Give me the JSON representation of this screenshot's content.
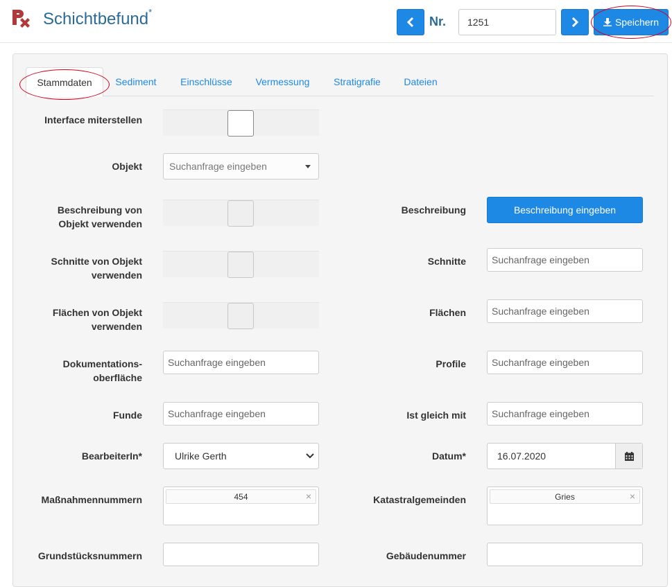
{
  "header": {
    "title": "Schichtbefund",
    "title_marker": "*",
    "nr_label": "Nr.",
    "nr_value": "1251",
    "save_label": "Speichern",
    "icons": [
      "app-logo-icon",
      "chevron-left-icon",
      "chevron-right-icon",
      "download-icon"
    ]
  },
  "tabs": [
    {
      "label": "Stammdaten",
      "active": true
    },
    {
      "label": "Sediment",
      "active": false
    },
    {
      "label": "Einschlüsse",
      "active": false
    },
    {
      "label": "Vermessung",
      "active": false
    },
    {
      "label": "Stratigrafie",
      "active": false
    },
    {
      "label": "Dateien",
      "active": false
    }
  ],
  "form": {
    "interface_label": "Interface miterstellen",
    "objekt_label": "Objekt",
    "objekt_placeholder": "Suchanfrage eingeben",
    "beschr_obj_label_1": "Beschreibung von",
    "beschr_obj_label_2": "Objekt verwenden",
    "beschreibung_label": "Beschreibung",
    "beschreibung_button": "Beschreibung eingeben",
    "schnitte_obj_label_1": "Schnitte von Objekt",
    "schnitte_obj_label_2": "verwenden",
    "schnitte_label": "Schnitte",
    "schnitte_placeholder": "Suchanfrage eingeben",
    "flaechen_obj_label_1": "Flächen von Objekt",
    "flaechen_obj_label_2": "verwenden",
    "flaechen_label": "Flächen",
    "flaechen_placeholder": "Suchanfrage eingeben",
    "doku_label_1": "Dokumentations-",
    "doku_label_2": "oberfläche",
    "doku_placeholder": "Suchanfrage eingeben",
    "profile_label": "Profile",
    "profile_placeholder": "Suchanfrage eingeben",
    "funde_label": "Funde",
    "funde_placeholder": "Suchanfrage eingeben",
    "gleich_label": "Ist gleich mit",
    "gleich_placeholder": "Suchanfrage eingeben",
    "bearbeiter_label": "BearbeiterIn*",
    "bearbeiter_value": "Ulrike Gerth",
    "datum_label": "Datum*",
    "datum_value": "16.07.2020",
    "massnahmen_label": "Maßnahmennummern",
    "massnahmen_tag": "454",
    "kataster_label": "Katastralgemeinden",
    "kataster_tag": "Gries",
    "grund_label": "Grundstücksnummern",
    "gebaeude_label": "Gebäudenummer",
    "tag_remove": "×"
  },
  "colors": {
    "accent": "#1e88e5",
    "title": "#2b6a97",
    "logo": "#b03a3a",
    "highlight_oval": "#d0021b"
  }
}
